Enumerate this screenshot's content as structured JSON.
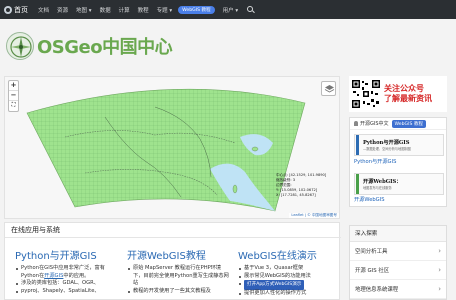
{
  "navbar": {
    "home": "首页",
    "items": [
      "文档",
      "资源",
      "地图",
      "数据",
      "计算",
      "教程",
      "专题"
    ],
    "badge": "WebGIS 教程",
    "user": "用户"
  },
  "logo": {
    "text": "OSGeo中国中心"
  },
  "map": {
    "zoom_in": "+",
    "zoom_out": "−",
    "fullscreen": "⛶",
    "info": {
      "center": "中心点: [42.1529, 101.9890]",
      "zoom": "缩放级别: 3",
      "bounds": "边界范围:",
      "sw": "Y: [15.0859, 102.0672]",
      "ne": "X: [17.7281, 45.8267]"
    },
    "attribution": "Leaflet | © 中国地图审图号"
  },
  "ad": {
    "line1": "关注公众号",
    "line2": "了解最新资讯"
  },
  "course_card": {
    "head": "开源GIS中文",
    "button": "WebGIS 教程",
    "books": [
      {
        "title": "Python与开源GIS",
        "subtitle": "—数据处理、空间分析与地图制图",
        "caption": "Python与开源GIS"
      },
      {
        "title": "开源WebGIS：",
        "subtitle": "地图发布与在线服务",
        "caption": "开源WebGIS"
      }
    ]
  },
  "section": {
    "title": "在线应用与系统",
    "columns": [
      {
        "heading": "Python与开源GIS",
        "items": [
          {
            "text": "Python在GIS中应用非常广泛，富有Python在",
            "link": "开源GIS",
            "tail": "中的应用。"
          },
          {
            "text": "涉及的类库包括：GDAL、OGR、"
          },
          {
            "text": "pyproj、Shapely、SpatiaLite、"
          }
        ]
      },
      {
        "heading": "开源WebGIS教程",
        "items": [
          {
            "text": "原始 MapServer 教程运行在PHP环境下，目前完全使用Python重写生成静态网站"
          },
          {
            "text": "教程的开发使用了一些其文教程及"
          }
        ]
      },
      {
        "heading": "WebGIS在线演示",
        "items": [
          {
            "text": "基于Vue 3，Quasar框架"
          },
          {
            "text": "展示常见WebGIS的功能用法"
          }
        ],
        "cta": "打开App方式WebGIS演示",
        "tail": "提供更加人性化的操作方式"
      }
    ]
  },
  "explore": {
    "title": "深入探索",
    "items": [
      "空间分析工具",
      "开源 GIS 社区",
      "地理信息系统课程"
    ]
  }
}
